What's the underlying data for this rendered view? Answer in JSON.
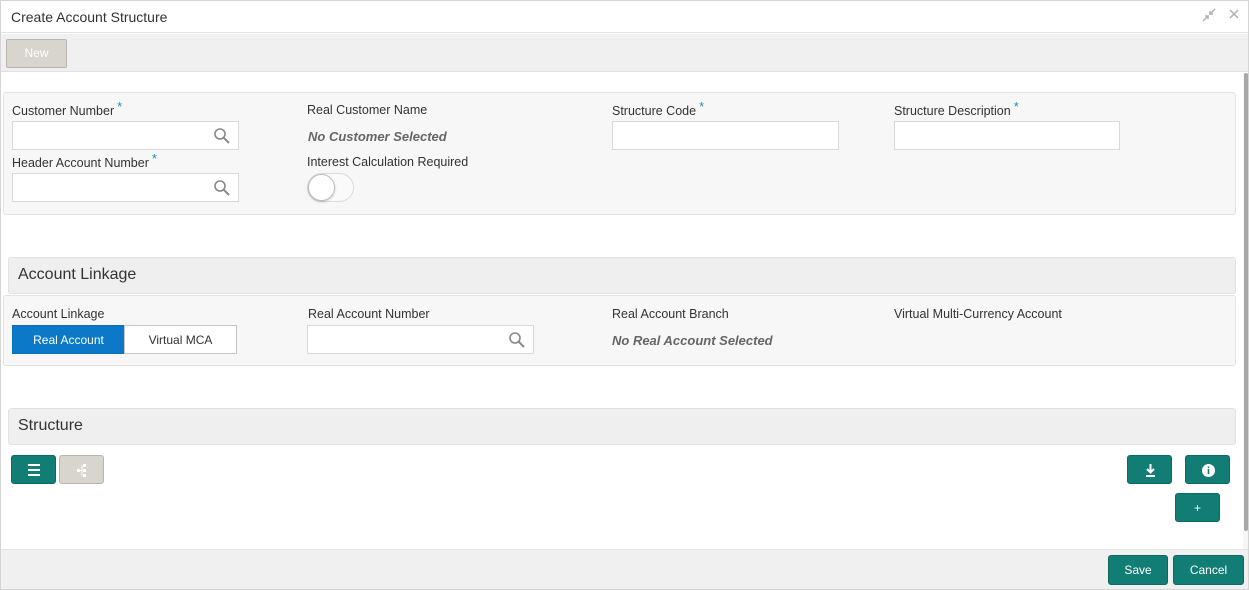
{
  "window": {
    "title": "Create Account Structure",
    "icons": [
      "minimize-icon",
      "close-icon"
    ]
  },
  "toolbar": {
    "new_label": "New"
  },
  "header_panel": {
    "customer_number": {
      "label": "Customer Number",
      "required": "*",
      "value": ""
    },
    "real_customer_name": {
      "label": "Real Customer Name",
      "value": "No Customer Selected"
    },
    "structure_code": {
      "label": "Structure Code",
      "required": "*",
      "value": ""
    },
    "structure_description": {
      "label": "Structure Description",
      "required": "*",
      "value": ""
    },
    "header_account_number": {
      "label": "Header Account Number",
      "required": "*",
      "value": ""
    },
    "interest_calculation": {
      "label": "Interest Calculation Required",
      "state": "off"
    }
  },
  "account_linkage": {
    "section_title": "Account Linkage",
    "linkage_label": "Account Linkage",
    "options": [
      "Real Account",
      "Virtual MCA"
    ],
    "selected": "Real Account",
    "real_account_number": {
      "label": "Real Account Number",
      "value": ""
    },
    "real_account_branch": {
      "label": "Real Account Branch",
      "value": "No Real Account Selected"
    },
    "virtual_mca": {
      "label": "Virtual Multi-Currency Account"
    }
  },
  "structure": {
    "section_title": "Structure",
    "buttons": [
      "list-view-icon",
      "tree-view-icon",
      "download-icon",
      "info-icon",
      "add-icon"
    ],
    "add_label": "+"
  },
  "footer": {
    "save_label": "Save",
    "cancel_label": "Cancel"
  },
  "colors": {
    "teal": "#117d74",
    "selected_blue": "#0b78c8",
    "required_star": "#1f8ecd",
    "disabled_grey": "#d8d4ce"
  }
}
